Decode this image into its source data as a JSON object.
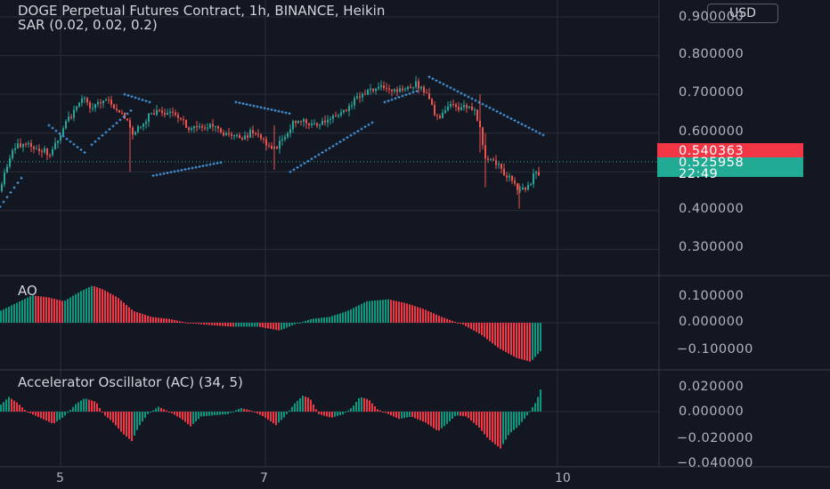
{
  "header": {
    "title": "DOGE Perpetual Futures Contract, 1h, BINANCE, Heikin",
    "indicator": "SAR (0.02, 0.02, 0.2)"
  },
  "currency_button": "USD",
  "panes": {
    "ao_label": "AO",
    "ac_label": "Accelerator Oscillator (AC) (34, 5)"
  },
  "price_axis": {
    "labels": [
      "0.900000",
      "0.800000",
      "0.700000",
      "0.600000",
      "0.400000",
      "0.300000"
    ]
  },
  "price_tags": {
    "red_value": "0.540363",
    "green_value": "0.525958",
    "green_countdown": "22:49"
  },
  "ao_axis": {
    "labels": [
      "0.100000",
      "0.000000",
      "−0.100000"
    ]
  },
  "ac_axis": {
    "labels": [
      "0.020000",
      "0.000000",
      "−0.020000",
      "−0.040000"
    ]
  },
  "time_axis": {
    "labels": [
      "5",
      "7",
      "10"
    ]
  },
  "colors": {
    "background": "#131722",
    "up": "#26a69a",
    "down": "#ef5350",
    "osc_up": "#089981",
    "osc_down": "#f23645",
    "sar": "#4aa3f0",
    "grid": "#2a2e39"
  },
  "chart_data": {
    "type": "candlestick",
    "symbol": "DOGE Perpetual Futures Contract",
    "interval": "1h",
    "exchange": "BINANCE",
    "price_range": [
      0.25,
      0.93
    ],
    "price_path": [
      [
        0,
        0.45
      ],
      [
        6,
        0.5
      ],
      [
        12,
        0.54
      ],
      [
        18,
        0.57
      ],
      [
        24,
        0.56
      ],
      [
        30,
        0.58
      ],
      [
        36,
        0.57
      ],
      [
        42,
        0.55
      ],
      [
        48,
        0.56
      ],
      [
        54,
        0.54
      ],
      [
        60,
        0.56
      ],
      [
        66,
        0.58
      ],
      [
        72,
        0.62
      ],
      [
        78,
        0.64
      ],
      [
        84,
        0.66
      ],
      [
        90,
        0.68
      ],
      [
        96,
        0.685
      ],
      [
        102,
        0.67
      ],
      [
        108,
        0.67
      ],
      [
        114,
        0.675
      ],
      [
        120,
        0.68
      ],
      [
        126,
        0.67
      ],
      [
        132,
        0.66
      ],
      [
        138,
        0.65
      ],
      [
        144,
        0.62
      ],
      [
        150,
        0.6
      ],
      [
        156,
        0.61
      ],
      [
        162,
        0.63
      ],
      [
        168,
        0.645
      ],
      [
        174,
        0.65
      ],
      [
        180,
        0.66
      ],
      [
        186,
        0.65
      ],
      [
        192,
        0.65
      ],
      [
        198,
        0.64
      ],
      [
        204,
        0.63
      ],
      [
        210,
        0.62
      ],
      [
        216,
        0.61
      ],
      [
        222,
        0.61
      ],
      [
        228,
        0.615
      ],
      [
        234,
        0.62
      ],
      [
        240,
        0.615
      ],
      [
        246,
        0.61
      ],
      [
        252,
        0.6
      ],
      [
        258,
        0.6
      ],
      [
        264,
        0.595
      ],
      [
        270,
        0.59
      ],
      [
        276,
        0.595
      ],
      [
        282,
        0.6
      ],
      [
        288,
        0.595
      ],
      [
        294,
        0.59
      ],
      [
        300,
        0.57
      ],
      [
        306,
        0.55
      ],
      [
        312,
        0.57
      ],
      [
        318,
        0.59
      ],
      [
        324,
        0.61
      ],
      [
        330,
        0.625
      ],
      [
        336,
        0.63
      ],
      [
        342,
        0.63
      ],
      [
        348,
        0.625
      ],
      [
        354,
        0.62
      ],
      [
        360,
        0.625
      ],
      [
        366,
        0.63
      ],
      [
        372,
        0.635
      ],
      [
        378,
        0.64
      ],
      [
        384,
        0.65
      ],
      [
        390,
        0.66
      ],
      [
        396,
        0.68
      ],
      [
        402,
        0.7
      ],
      [
        408,
        0.7
      ],
      [
        414,
        0.705
      ],
      [
        420,
        0.71
      ],
      [
        426,
        0.715
      ],
      [
        432,
        0.72
      ],
      [
        438,
        0.71
      ],
      [
        444,
        0.705
      ],
      [
        450,
        0.715
      ],
      [
        456,
        0.72
      ],
      [
        462,
        0.725
      ],
      [
        468,
        0.725
      ],
      [
        474,
        0.72
      ],
      [
        480,
        0.69
      ],
      [
        486,
        0.66
      ],
      [
        492,
        0.64
      ],
      [
        498,
        0.655
      ],
      [
        504,
        0.675
      ],
      [
        510,
        0.665
      ],
      [
        516,
        0.66
      ],
      [
        522,
        0.665
      ],
      [
        528,
        0.67
      ],
      [
        534,
        0.65
      ],
      [
        540,
        0.6
      ],
      [
        546,
        0.52
      ],
      [
        552,
        0.53
      ],
      [
        558,
        0.52
      ],
      [
        564,
        0.5
      ],
      [
        570,
        0.49
      ],
      [
        576,
        0.47
      ],
      [
        582,
        0.45
      ],
      [
        588,
        0.45
      ],
      [
        594,
        0.47
      ],
      [
        600,
        0.49
      ],
      [
        606,
        0.5
      ]
    ],
    "sar_segments": [
      {
        "from": 0,
        "to": 26,
        "start": 0.41,
        "end": 0.49
      },
      {
        "from": 55,
        "to": 95,
        "start": 0.62,
        "end": 0.55
      },
      {
        "from": 103,
        "to": 148,
        "start": 0.57,
        "end": 0.66
      },
      {
        "from": 140,
        "to": 168,
        "start": 0.7,
        "end": 0.68
      },
      {
        "from": 172,
        "to": 250,
        "start": 0.49,
        "end": 0.525
      },
      {
        "from": 265,
        "to": 326,
        "start": 0.68,
        "end": 0.65
      },
      {
        "from": 326,
        "to": 420,
        "start": 0.5,
        "end": 0.63
      },
      {
        "from": 432,
        "to": 470,
        "start": 0.68,
        "end": 0.71
      },
      {
        "from": 482,
        "to": 610,
        "start": 0.745,
        "end": 0.595
      }
    ],
    "ao_range": [
      -0.11,
      0.125
    ],
    "ao_path": [
      [
        0,
        0.03
      ],
      [
        18,
        0.05
      ],
      [
        36,
        0.07
      ],
      [
        54,
        0.065
      ],
      [
        72,
        0.055
      ],
      [
        90,
        0.08
      ],
      [
        104,
        0.095
      ],
      [
        116,
        0.085
      ],
      [
        132,
        0.065
      ],
      [
        150,
        0.03
      ],
      [
        170,
        0.015
      ],
      [
        190,
        0.01
      ],
      [
        210,
        0.0
      ],
      [
        230,
        -0.005
      ],
      [
        260,
        -0.01
      ],
      [
        290,
        -0.01
      ],
      [
        314,
        -0.02
      ],
      [
        330,
        -0.005
      ],
      [
        350,
        0.01
      ],
      [
        370,
        0.015
      ],
      [
        390,
        0.03
      ],
      [
        412,
        0.055
      ],
      [
        436,
        0.06
      ],
      [
        456,
        0.05
      ],
      [
        476,
        0.035
      ],
      [
        496,
        0.015
      ],
      [
        520,
        -0.005
      ],
      [
        540,
        -0.03
      ],
      [
        560,
        -0.065
      ],
      [
        580,
        -0.09
      ],
      [
        596,
        -0.1
      ],
      [
        608,
        -0.07
      ]
    ],
    "ac_range": [
      -0.042,
      0.027
    ],
    "ac_path": [
      [
        0,
        0.005
      ],
      [
        10,
        0.012
      ],
      [
        20,
        0.007
      ],
      [
        30,
        0.0
      ],
      [
        45,
        -0.005
      ],
      [
        60,
        -0.01
      ],
      [
        72,
        -0.004
      ],
      [
        85,
        0.006
      ],
      [
        95,
        0.011
      ],
      [
        108,
        0.008
      ],
      [
        116,
        -0.002
      ],
      [
        126,
        -0.008
      ],
      [
        138,
        -0.018
      ],
      [
        148,
        -0.024
      ],
      [
        156,
        -0.012
      ],
      [
        166,
        -0.002
      ],
      [
        178,
        0.004
      ],
      [
        190,
        0.0
      ],
      [
        204,
        -0.006
      ],
      [
        214,
        -0.012
      ],
      [
        226,
        -0.004
      ],
      [
        240,
        -0.003
      ],
      [
        256,
        -0.002
      ],
      [
        270,
        0.003
      ],
      [
        282,
        0.001
      ],
      [
        296,
        -0.004
      ],
      [
        310,
        -0.011
      ],
      [
        320,
        -0.004
      ],
      [
        330,
        0.006
      ],
      [
        340,
        0.013
      ],
      [
        348,
        0.011
      ],
      [
        358,
        -0.002
      ],
      [
        372,
        -0.005
      ],
      [
        386,
        -0.002
      ],
      [
        396,
        0.004
      ],
      [
        404,
        0.012
      ],
      [
        414,
        0.01
      ],
      [
        424,
        0.002
      ],
      [
        436,
        -0.002
      ],
      [
        448,
        -0.006
      ],
      [
        462,
        -0.004
      ],
      [
        478,
        -0.009
      ],
      [
        492,
        -0.016
      ],
      [
        502,
        -0.01
      ],
      [
        512,
        -0.003
      ],
      [
        524,
        -0.004
      ],
      [
        538,
        -0.013
      ],
      [
        548,
        -0.022
      ],
      [
        562,
        -0.03
      ],
      [
        572,
        -0.018
      ],
      [
        582,
        -0.012
      ],
      [
        592,
        -0.003
      ],
      [
        602,
        0.008
      ],
      [
        608,
        0.02
      ]
    ]
  }
}
